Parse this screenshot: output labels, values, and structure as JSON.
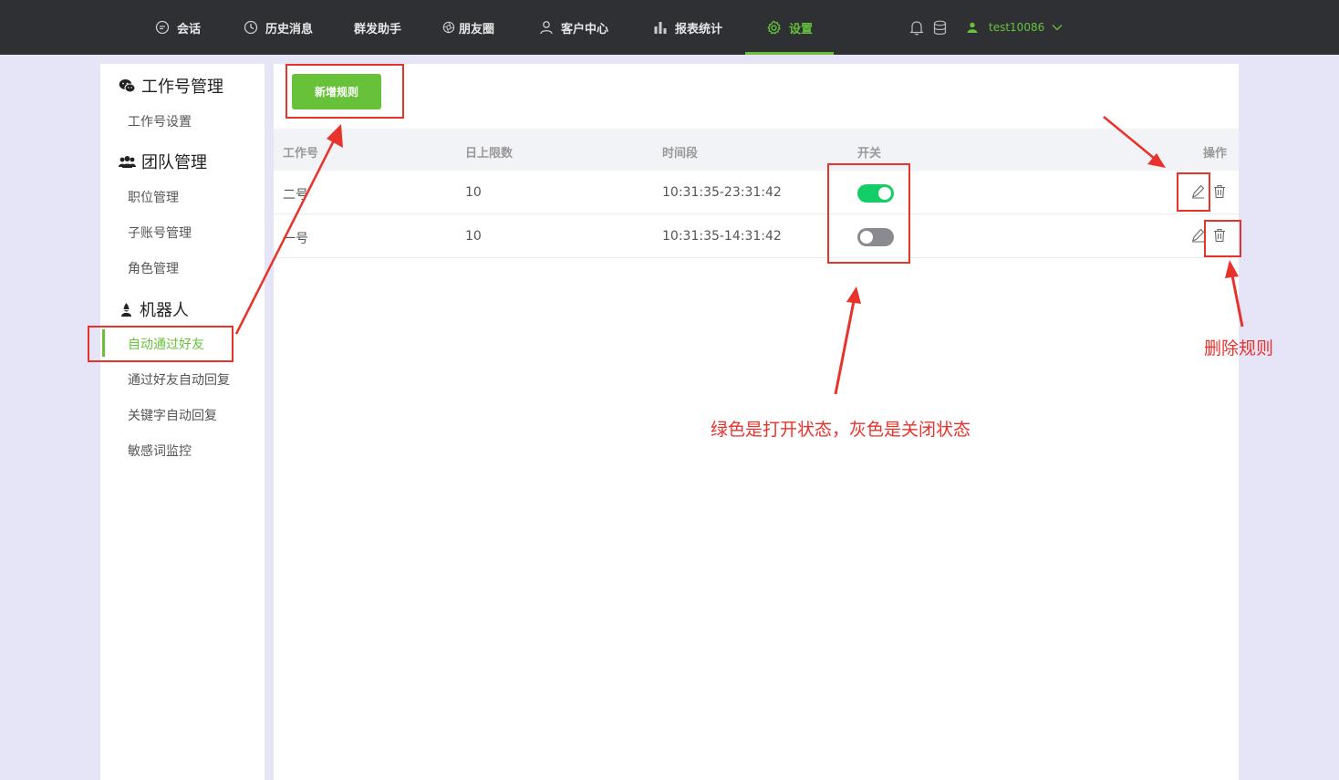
{
  "nav": {
    "items": [
      {
        "label": "会话",
        "icon": "chat-icon"
      },
      {
        "label": "历史消息",
        "icon": "clock-icon"
      },
      {
        "label": "群发助手",
        "icon": ""
      },
      {
        "label": "朋友圈",
        "icon": "aperture-icon"
      },
      {
        "label": "客户中心",
        "icon": "person-icon"
      },
      {
        "label": "报表统计",
        "icon": "bar-chart-icon"
      },
      {
        "label": "设置",
        "icon": "gear-icon"
      }
    ],
    "active": "设置",
    "username": "test10086"
  },
  "sidebar": {
    "groups": [
      {
        "title": "工作号管理",
        "icon": "wechat-icon",
        "items": [
          "工作号设置"
        ]
      },
      {
        "title": "团队管理",
        "icon": "team-icon",
        "items": [
          "职位管理",
          "子账号管理",
          "角色管理"
        ]
      },
      {
        "title": "机器人",
        "icon": "robot-icon",
        "items": [
          "自动通过好友",
          "通过好友自动回复",
          "关键字自动回复",
          "敏感词监控"
        ]
      }
    ],
    "active_item": "自动通过好友"
  },
  "toolbar": {
    "add_label": "新增规则"
  },
  "table": {
    "headers": [
      "工作号",
      "日上限数",
      "时间段",
      "开关",
      "操作"
    ],
    "rows": [
      {
        "name": "二号",
        "limit": "10",
        "period": "10:31:35-23:31:42",
        "on": true
      },
      {
        "name": "一号",
        "limit": "10",
        "period": "10:31:35-14:31:42",
        "on": false
      }
    ]
  },
  "annotations": {
    "switch_note": "绿色是打开状态，灰色是关闭状态",
    "delete_note": "删除规则"
  },
  "colors": {
    "accent": "#67c23a",
    "switch_on": "#13ce66",
    "switch_off": "#8a8b90",
    "annotation": "#e8322c",
    "nav_bg": "#2e3034"
  }
}
